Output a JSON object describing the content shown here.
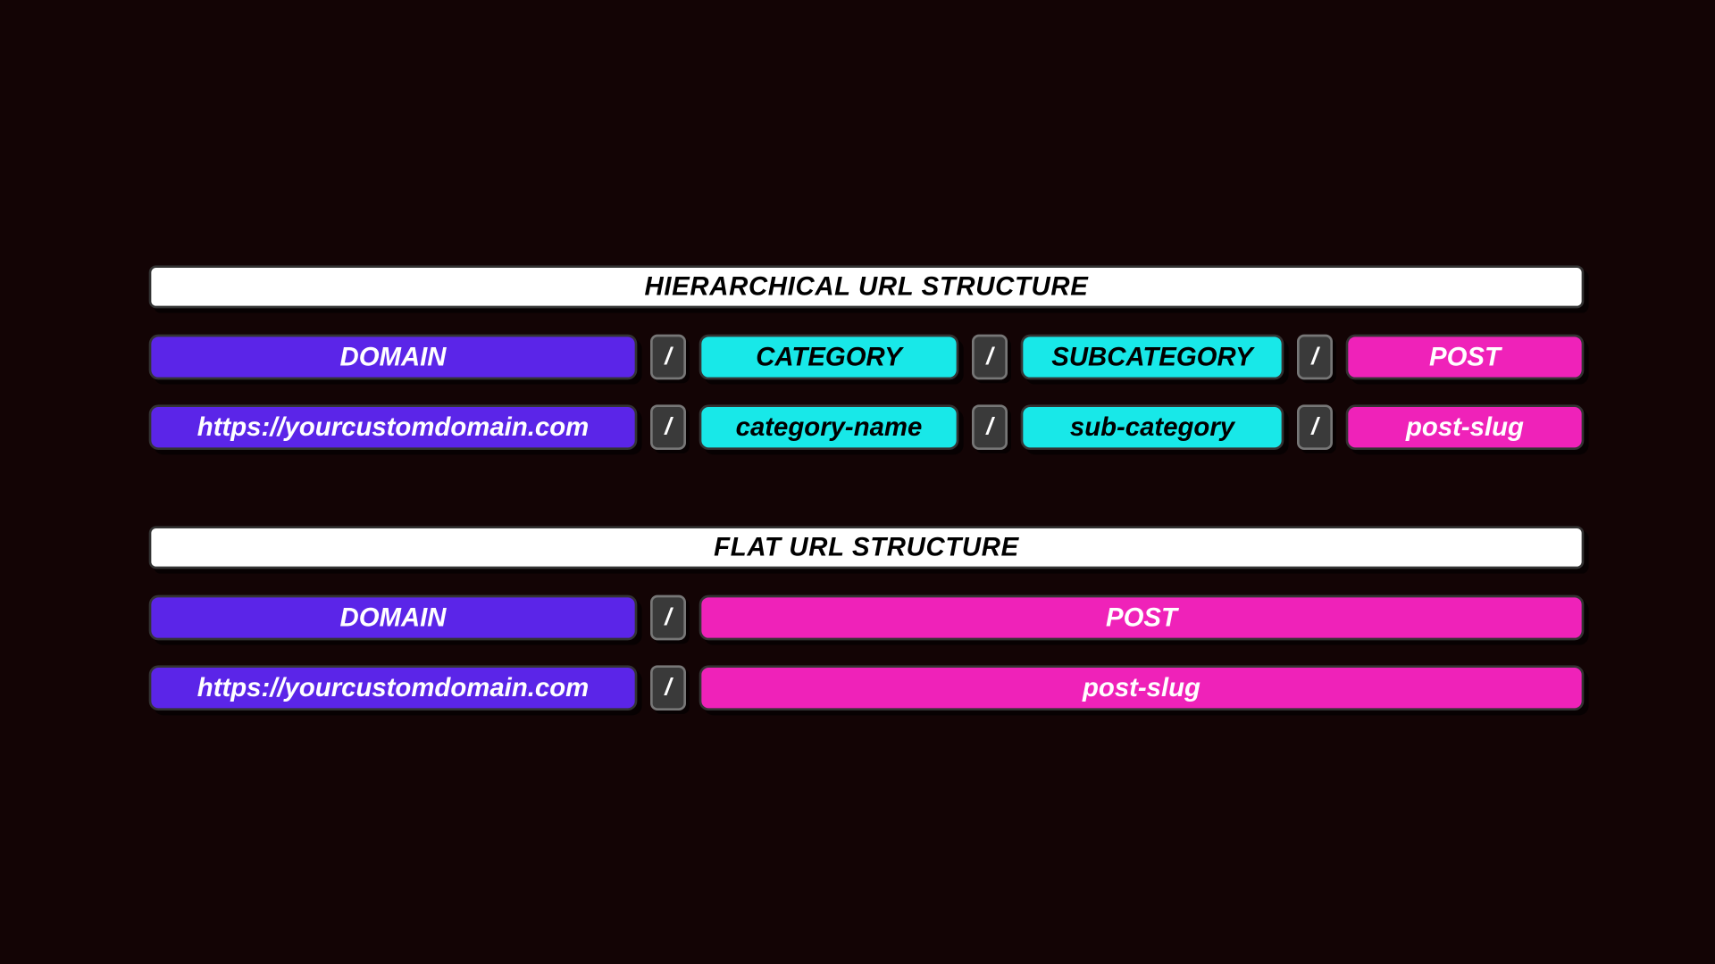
{
  "slash": "/",
  "hierarchical": {
    "title": "HIERARCHICAL URL STRUCTURE",
    "labels": {
      "domain": "DOMAIN",
      "category": "CATEGORY",
      "subcategory": "SUBCATEGORY",
      "post": "POST"
    },
    "example": {
      "domain": "https://yourcustomdomain.com",
      "category": "category-name",
      "subcategory": "sub-category",
      "post": "post-slug"
    }
  },
  "flat": {
    "title": "FLAT URL STRUCTURE",
    "labels": {
      "domain": "DOMAIN",
      "post": "POST"
    },
    "example": {
      "domain": "https://yourcustomdomain.com",
      "post": "post-slug"
    }
  },
  "colors": {
    "domain": "#5b25e8",
    "category": "#18e8e8",
    "subcategory": "#18e8e8",
    "post": "#ef22b9",
    "background": "#130405"
  }
}
